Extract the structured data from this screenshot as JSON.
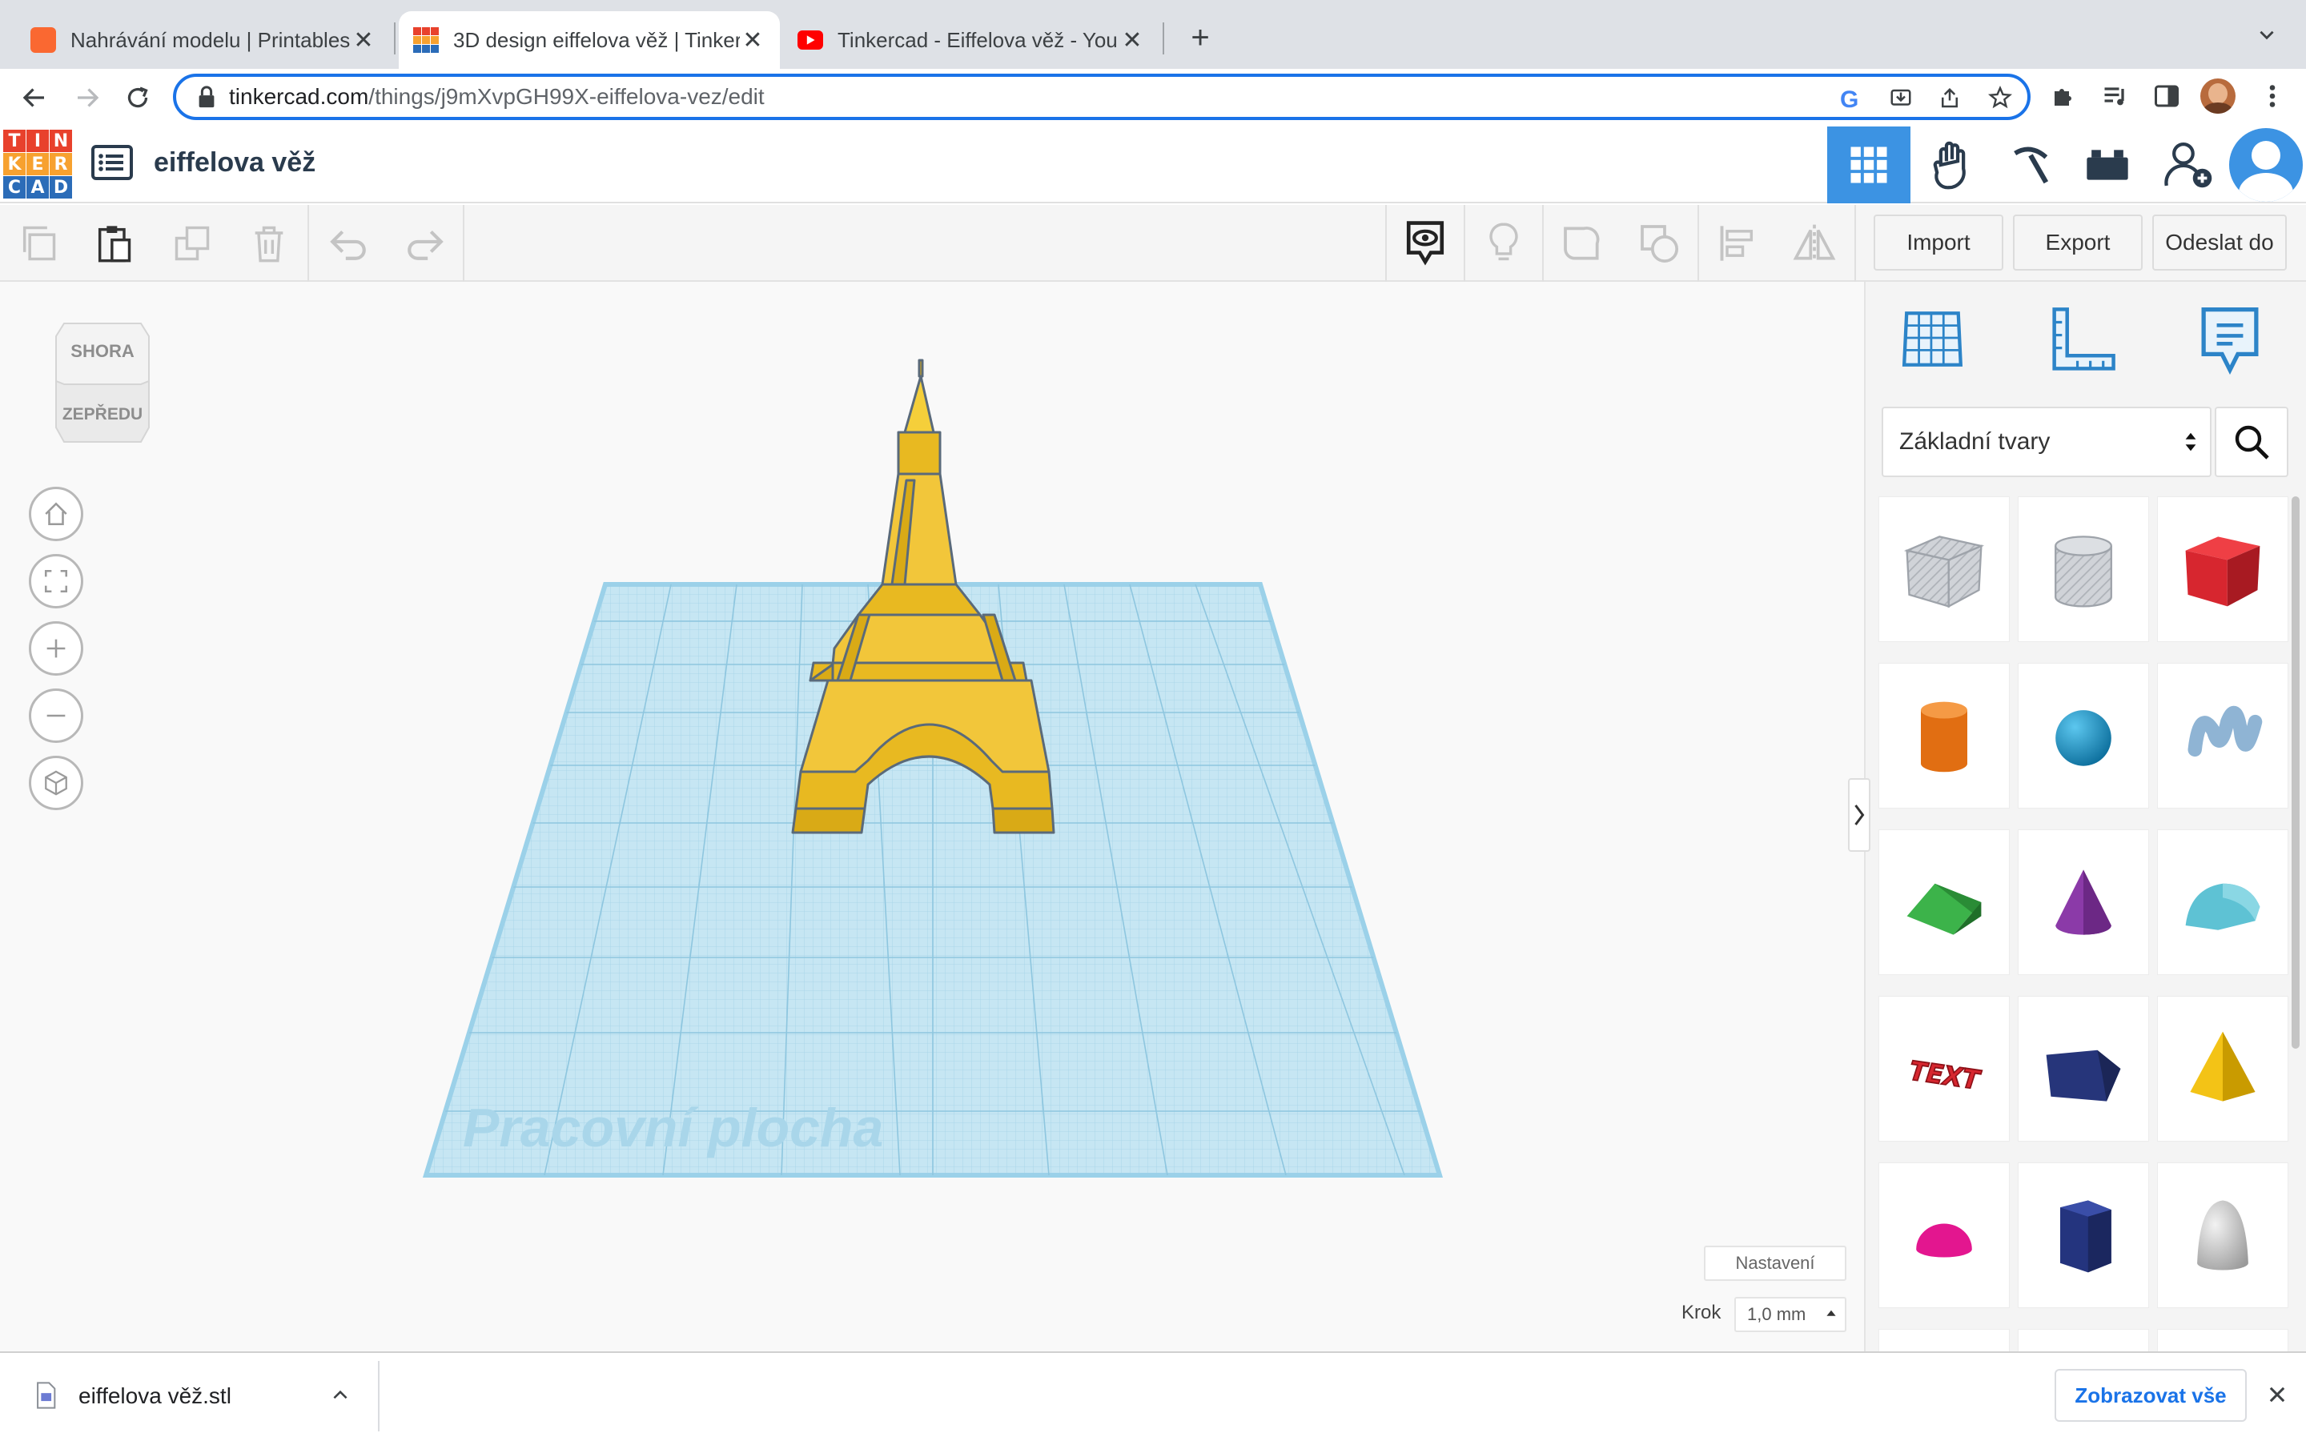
{
  "browser": {
    "tabs": [
      {
        "title": "Nahrávání modelu | Printables.c",
        "active": false,
        "favicon_color": "#fa6831"
      },
      {
        "title": "3D design eiffelova věž | Tinker",
        "active": true,
        "favicon_color": "#1477d1"
      },
      {
        "title": "Tinkercad - Eiffelova věž - You",
        "active": false,
        "favicon_color": "#ff0000"
      }
    ],
    "new_tab_label": "+",
    "url_host": "tinkercad.com",
    "url_path": "/things/j9mXvpGH99X-eiffelova-vez/edit"
  },
  "app": {
    "logo_letters": [
      "T",
      "I",
      "N",
      "K",
      "E",
      "R",
      "C",
      "A",
      "D"
    ],
    "logo_colors": [
      "#e8412c",
      "#e8412c",
      "#e8412c",
      "#f7a12f",
      "#f7a12f",
      "#f7a12f",
      "#2b6cb8",
      "#2b6cb8",
      "#2b6cb8"
    ],
    "design_title": "eiffelova věž",
    "header_buttons": [
      "3d-view",
      "tinker-gallery",
      "minecraft-pickaxe",
      "bricks",
      "add-user",
      "profile"
    ],
    "actions": {
      "import": "Import",
      "export": "Export",
      "send": "Odeslat do"
    }
  },
  "viewcube": {
    "top": "SHORA",
    "front": "ZEPŘEDU"
  },
  "workplane": {
    "label": "Pracovní plocha",
    "color": "#bfe3f1"
  },
  "panel": {
    "category": "Základní tvary",
    "shapes": [
      {
        "name": "box-hole",
        "color": "#c9ccd1"
      },
      {
        "name": "cylinder-hole",
        "color": "#c9ccd1"
      },
      {
        "name": "box",
        "color": "#d7262f"
      },
      {
        "name": "cylinder",
        "color": "#ec7a1c"
      },
      {
        "name": "sphere",
        "color": "#1d9ed6"
      },
      {
        "name": "scribble",
        "color": "#7fa7c9"
      },
      {
        "name": "roof",
        "color": "#2e9e3a"
      },
      {
        "name": "cone",
        "color": "#8b3aa8"
      },
      {
        "name": "round-roof",
        "color": "#5ec2d4"
      },
      {
        "name": "text",
        "color": "#d7262f"
      },
      {
        "name": "polygon",
        "color": "#26357a"
      },
      {
        "name": "pyramid",
        "color": "#f3c316"
      },
      {
        "name": "half-sphere",
        "color": "#e3168f"
      },
      {
        "name": "hexagon-prism",
        "color": "#24347e"
      },
      {
        "name": "paraboloid",
        "color": "#d6d6d6"
      }
    ]
  },
  "bottom_controls": {
    "settings": "Nastavení",
    "step_label": "Krok",
    "step_value": "1,0 mm"
  },
  "download": {
    "file": "eiffelova věž.stl",
    "show_all": "Zobrazovat vše"
  }
}
